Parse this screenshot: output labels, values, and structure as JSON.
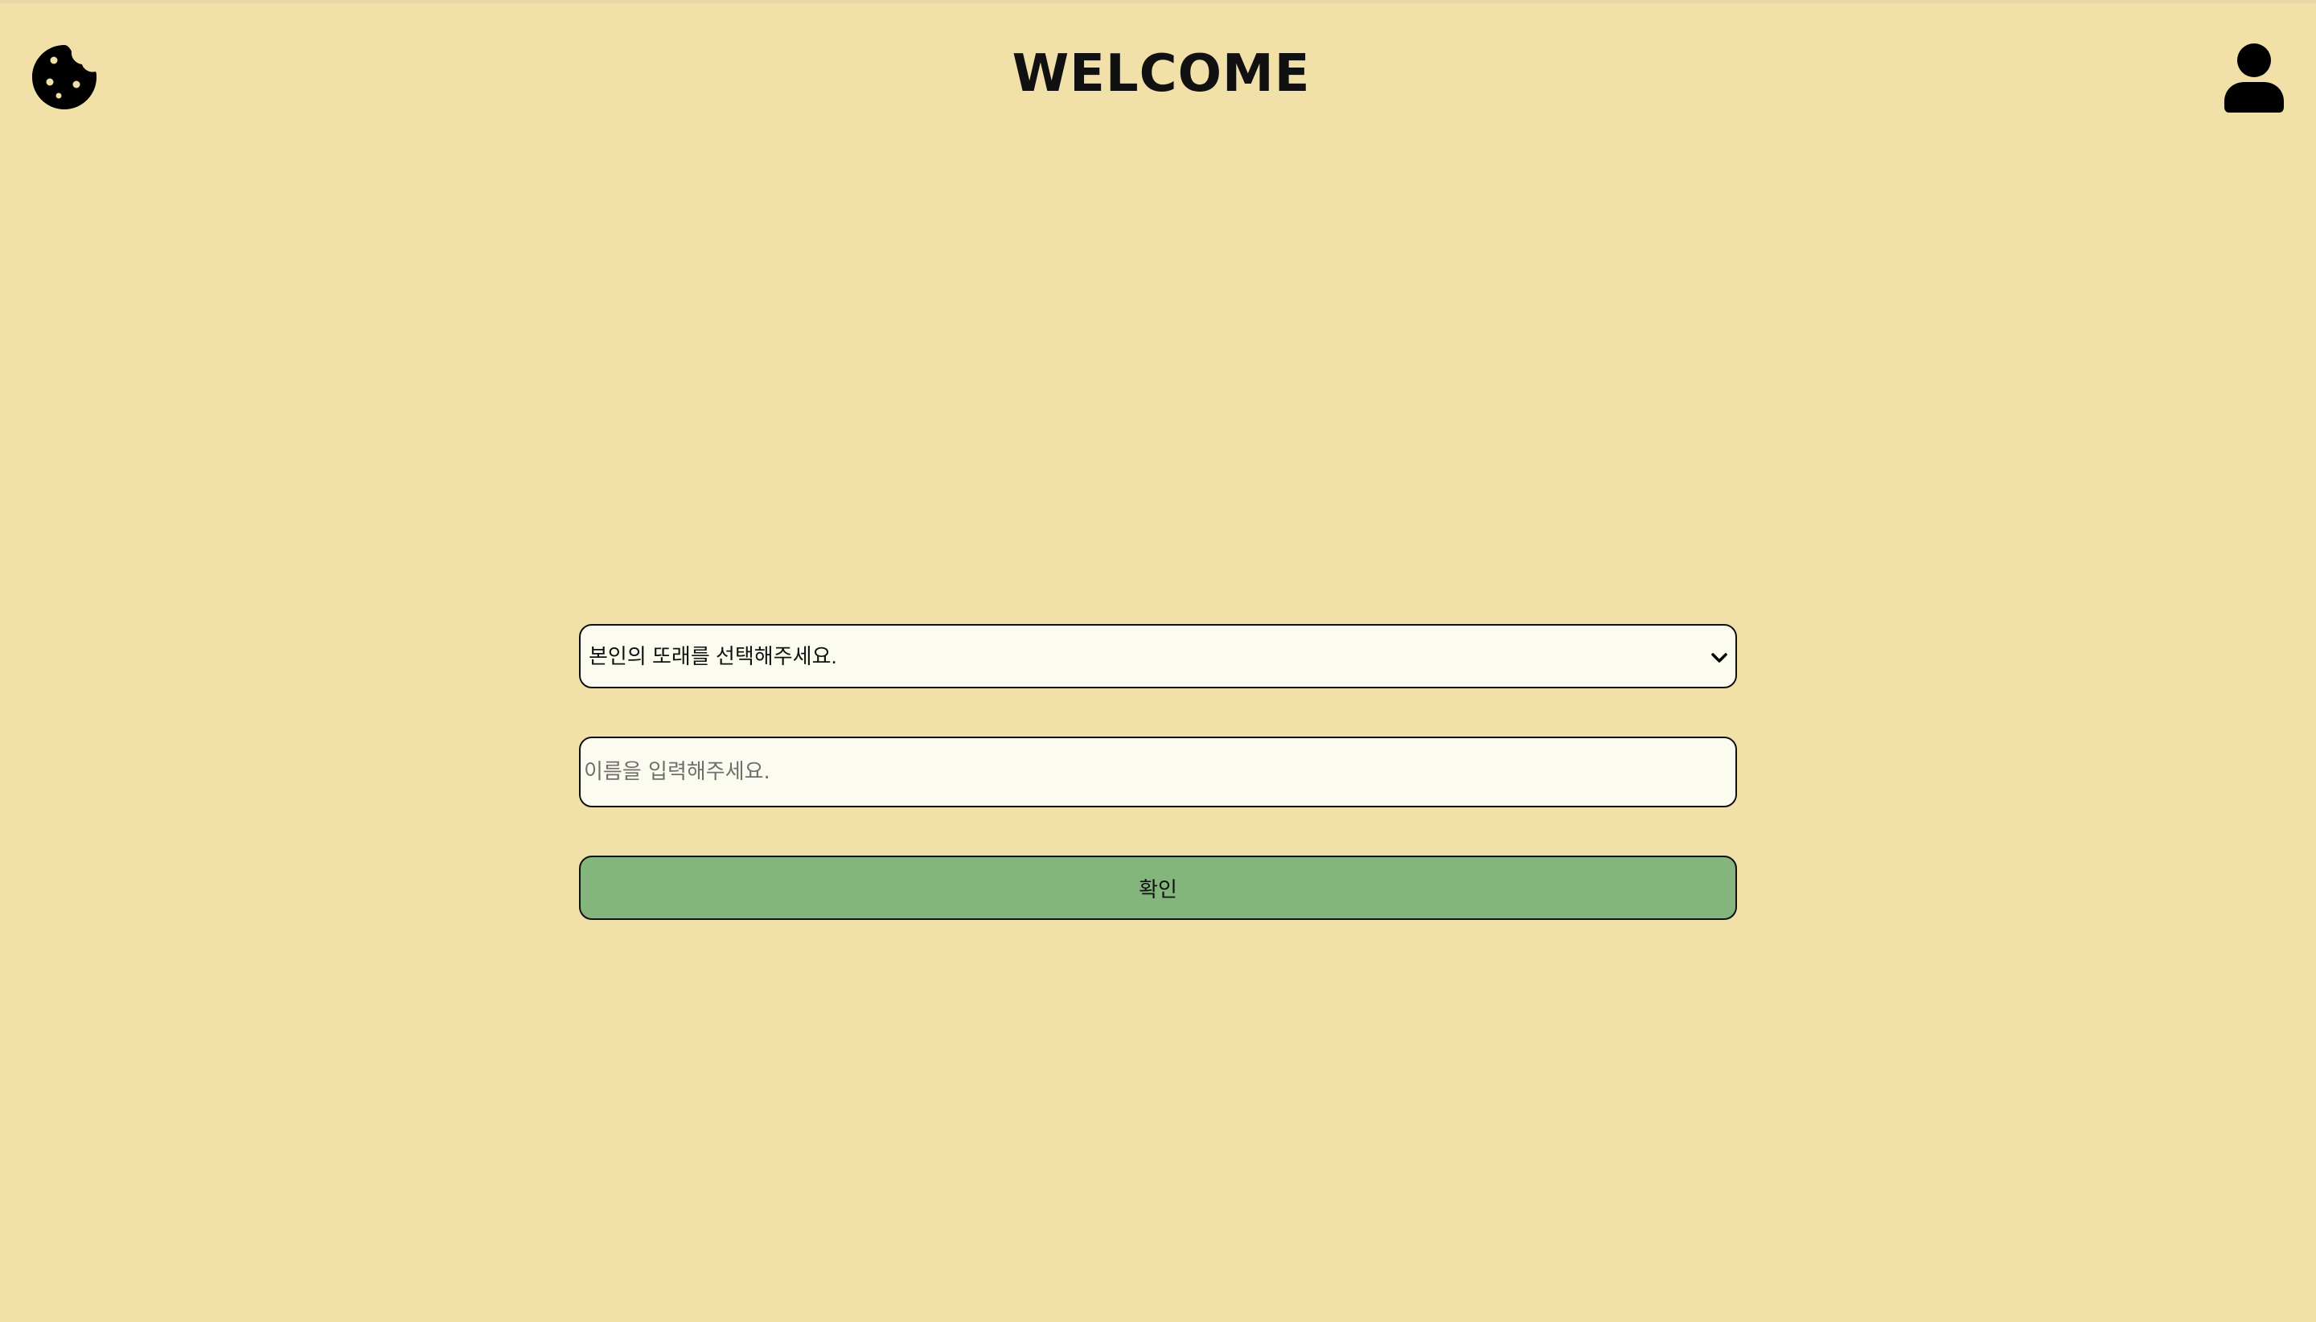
{
  "header": {
    "title": "WELCOME",
    "left_icon": "cookie-icon",
    "right_icon": "user-icon"
  },
  "form": {
    "peer_select": {
      "selected_label": "본인의 또래를 선택해주세요."
    },
    "name_input": {
      "value": "",
      "placeholder": "이름을 입력해주세요."
    },
    "confirm_label": "확인"
  },
  "colors": {
    "background": "#f1e0a8",
    "field_background": "#fcfbef",
    "confirm_button": "#83b57d",
    "border": "#111111"
  }
}
